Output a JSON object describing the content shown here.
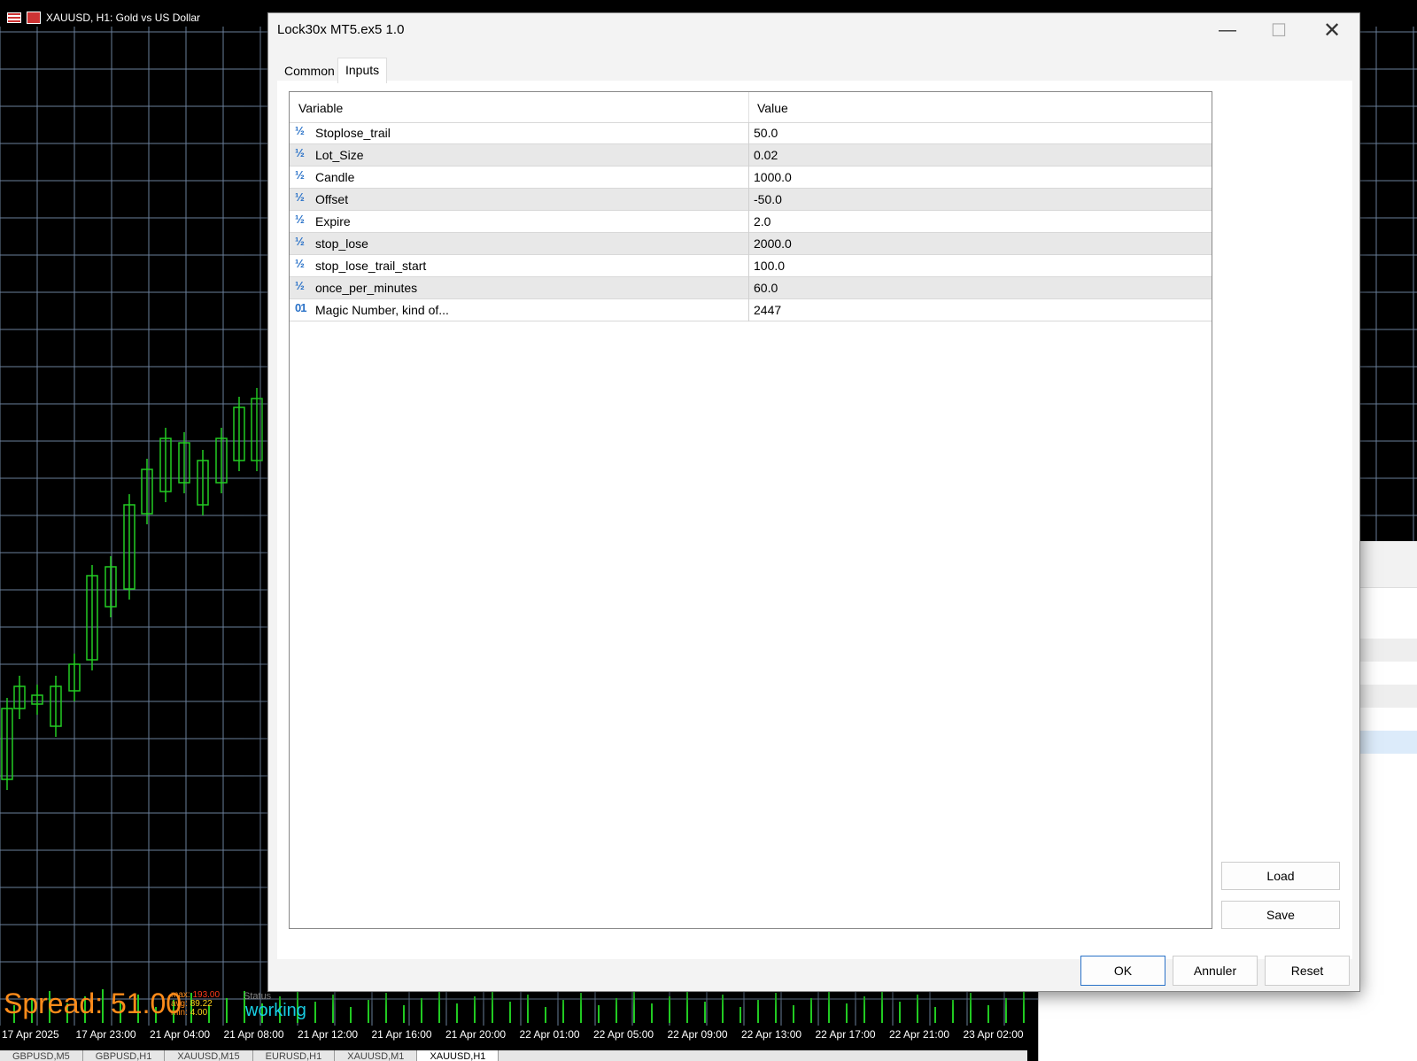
{
  "chart": {
    "symbol_title": "XAUUSD, H1:  Gold vs US Dollar",
    "time_axis": [
      "17 Apr 2025",
      "17 Apr 23:00",
      "21 Apr 04:00",
      "21 Apr 08:00",
      "21 Apr 12:00",
      "21 Apr 16:00",
      "21 Apr 20:00",
      "22 Apr 01:00",
      "22 Apr 05:00",
      "22 Apr 09:00",
      "22 Apr 13:00",
      "22 Apr 17:00",
      "22 Apr 21:00",
      "23 Apr 02:00"
    ],
    "spread_text": "Spread: 51.00",
    "stats": {
      "max_label": "max:",
      "max_value": "193.00",
      "avg_label": "avg:",
      "avg_value": "89.22",
      "min_label": "min:",
      "min_value": "4.00"
    },
    "status_label": "Status",
    "status_value": "working",
    "bottom_tabs": [
      "GBPUSD,M5",
      "GBPUSD,H1",
      "XAUUSD,M15",
      "EURUSD,H1",
      "XAUUSD,M1",
      "XAUUSD,H1"
    ],
    "colors": {
      "background": "#000000",
      "grid": "#6a7f9a",
      "bull": "#22cc22",
      "spread": "#ff8c1a",
      "status": "#19d0e6"
    }
  },
  "dialog": {
    "title": "Lock30x MT5.ex5 1.0",
    "tabs": [
      "Common",
      "Inputs"
    ],
    "active_tab": "Inputs",
    "table": {
      "headers": {
        "variable": "Variable",
        "value": "Value"
      },
      "rows": [
        {
          "type_icon": "½",
          "name": "Stoplose_trail",
          "value": "50.0"
        },
        {
          "type_icon": "½",
          "name": "Lot_Size",
          "value": "0.02"
        },
        {
          "type_icon": "½",
          "name": "Candle",
          "value": "1000.0"
        },
        {
          "type_icon": "½",
          "name": "Offset",
          "value": "-50.0"
        },
        {
          "type_icon": "½",
          "name": "Expire",
          "value": "2.0"
        },
        {
          "type_icon": "½",
          "name": "stop_lose",
          "value": "2000.0"
        },
        {
          "type_icon": "½",
          "name": "stop_lose_trail_start",
          "value": "100.0"
        },
        {
          "type_icon": "½",
          "name": "once_per_minutes",
          "value": "60.0"
        },
        {
          "type_icon": "01",
          "name": "Magic Number, kind of...",
          "value": "2447"
        }
      ]
    },
    "buttons": {
      "load": "Load",
      "save": "Save",
      "ok": "OK",
      "cancel": "Annuler",
      "reset": "Reset"
    },
    "window_controls": {
      "minimize": "—",
      "maximize": "☐",
      "close": "✕"
    },
    "accent_color": "#2a72c8"
  }
}
